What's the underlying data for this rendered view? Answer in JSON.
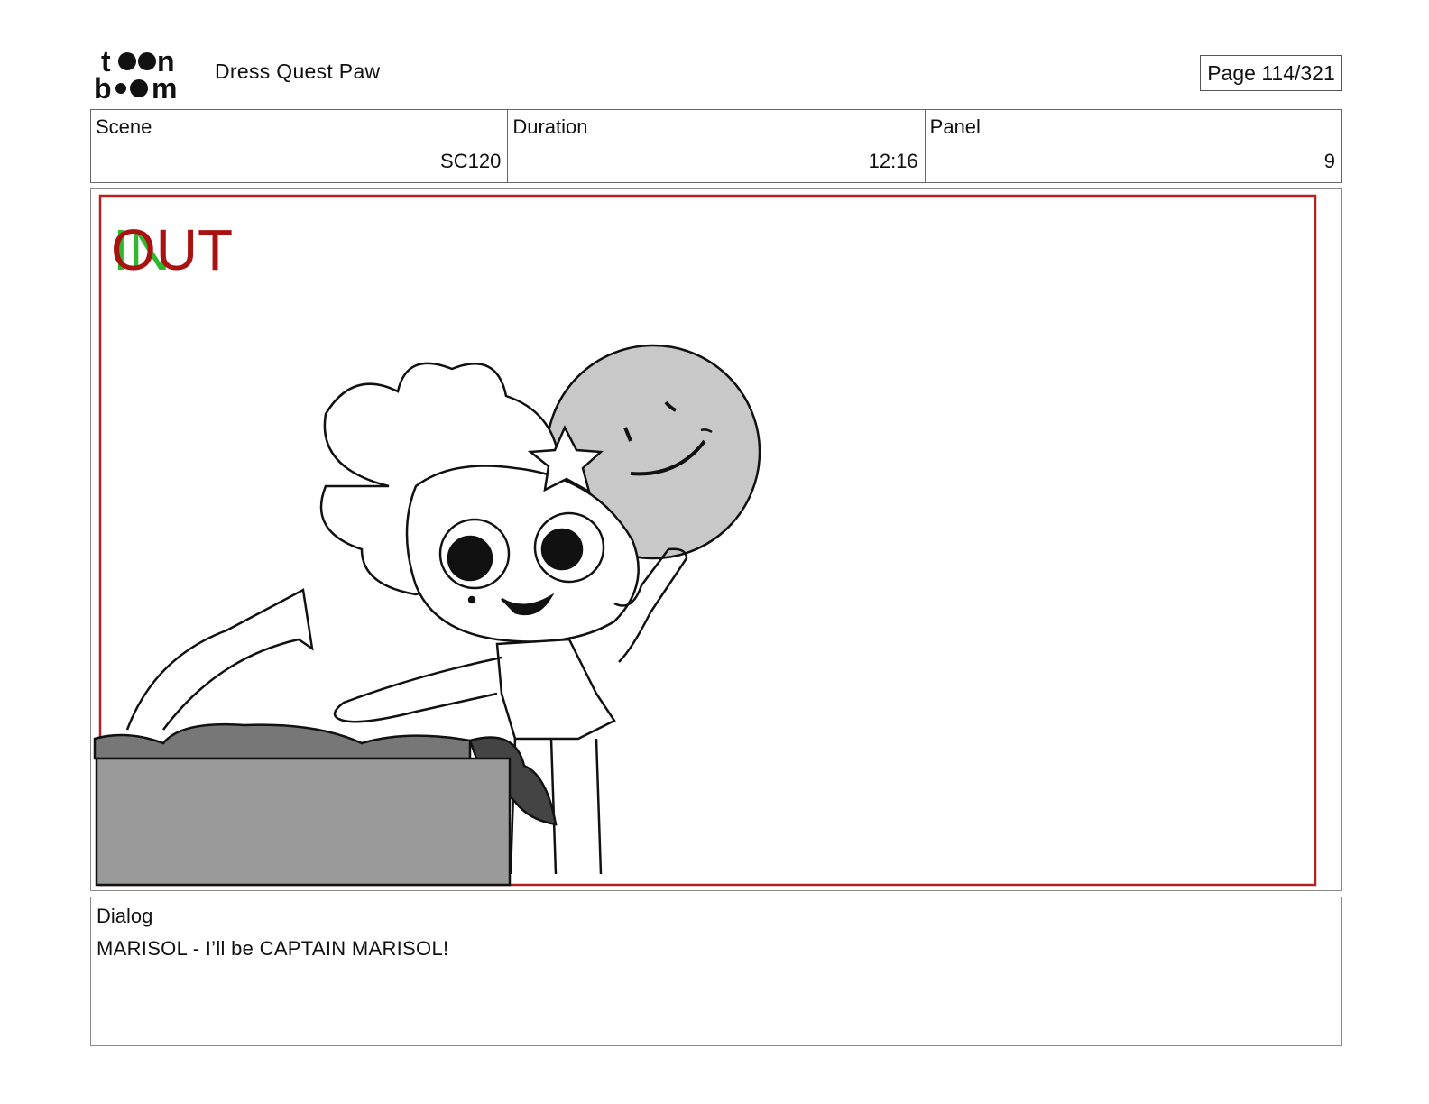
{
  "header": {
    "logo_text": [
      "to",
      "on",
      "bo",
      "om"
    ],
    "project_title": "Dress Quest Paw",
    "page_label": "Page 114/321"
  },
  "info": {
    "scene_label": "Scene",
    "scene_value": "SC120",
    "duration_label": "Duration",
    "duration_value": "12:16",
    "panel_label": "Panel",
    "panel_value": "9"
  },
  "panel": {
    "in_marker": "IN",
    "out_marker": "OUT",
    "colors": {
      "in": "#2db82d",
      "out": "#aa1111",
      "safe_frame": "#b22222"
    }
  },
  "dialog": {
    "label": "Dialog",
    "text": "MARISOL - I’ll be CAPTAIN MARISOL!"
  }
}
